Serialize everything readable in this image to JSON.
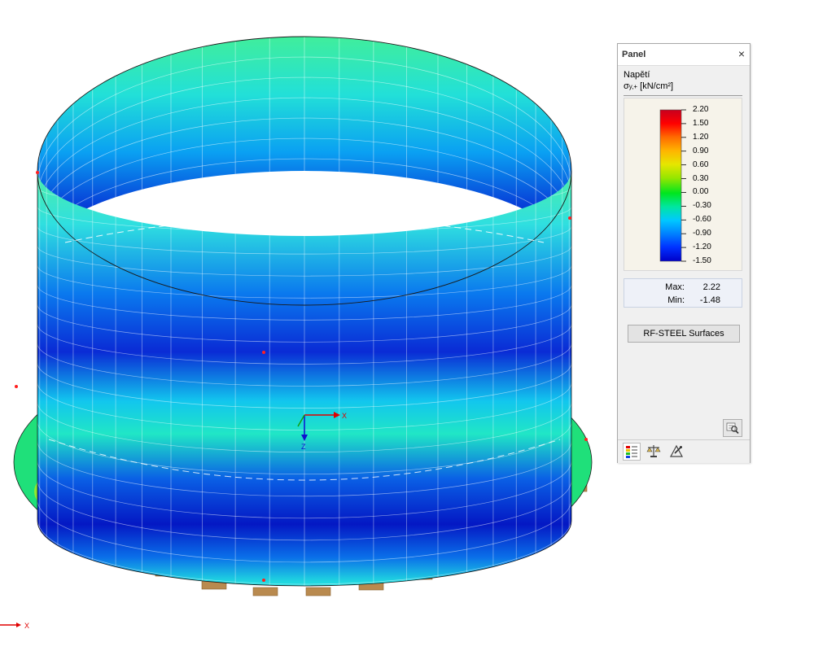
{
  "panel": {
    "title": "Panel",
    "close_glyph": "×",
    "result_name": "Napětí",
    "quantity_symbol": "σ",
    "quantity_subscript": "y,+",
    "quantity_unit": " [kN/cm²]",
    "legend_values": [
      "2.20",
      "1.50",
      "1.20",
      "0.90",
      "0.60",
      "0.30",
      "0.00",
      "-0.30",
      "-0.60",
      "-0.90",
      "-1.20",
      "-1.50"
    ],
    "legend_colors": [
      "#c8001e",
      "#ff0000",
      "#ff6a00",
      "#ffb400",
      "#e6e600",
      "#96e600",
      "#00e61e",
      "#00e6a0",
      "#00c8ff",
      "#0080ff",
      "#0030ff",
      "#0000c8"
    ],
    "max_label": "Max:",
    "max_value": "2.22",
    "min_label": "Min:",
    "min_value": "-1.48",
    "addon_button_label": "RF-STEEL Surfaces",
    "tabs": [
      {
        "icon": "color-scale-icon"
      },
      {
        "icon": "balance-icon"
      },
      {
        "icon": "factor-icon"
      }
    ]
  },
  "view": {
    "axis_x_label": "X",
    "axis_z_label": "Z",
    "global_axis_x_label": "X",
    "support_color": "#b98a4f",
    "mesh_color": "#ffffff"
  }
}
